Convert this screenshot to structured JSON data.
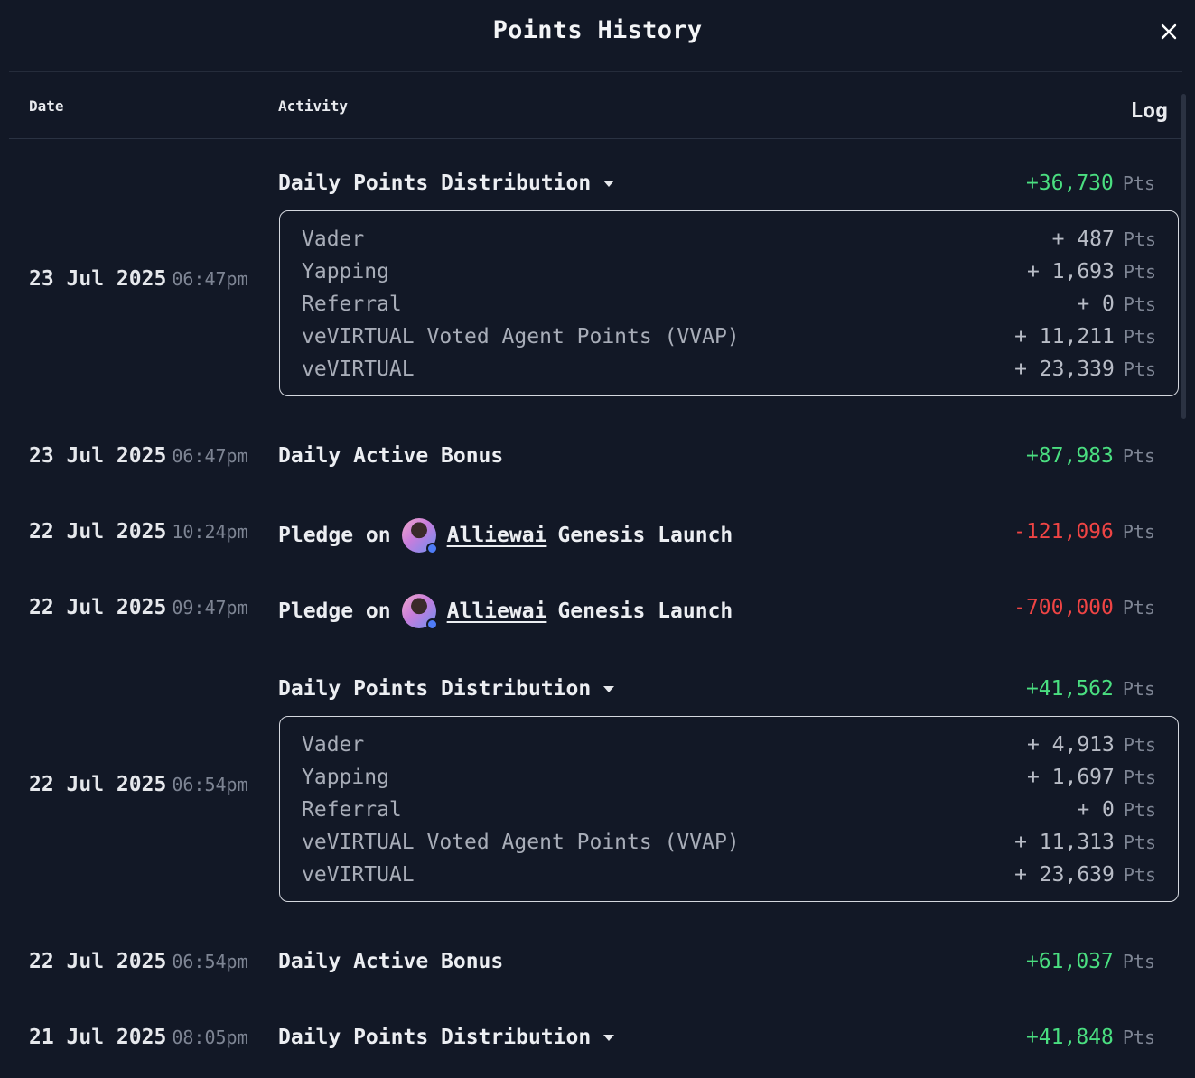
{
  "modal": {
    "title": "Points History",
    "close_label": "×"
  },
  "table": {
    "headers": {
      "date": "Date",
      "activity": "Activity",
      "log": "Log"
    }
  },
  "unit": "Pts",
  "rows": [
    {
      "date": "23 Jul 2025",
      "time": "06:47pm",
      "activity": "Daily Points Distribution",
      "amount": "+36,730",
      "breakdown": [
        {
          "label": "Vader",
          "value": "+ 487"
        },
        {
          "label": "Yapping",
          "value": "+ 1,693"
        },
        {
          "label": "Referral",
          "value": "+ 0"
        },
        {
          "label": "veVIRTUAL Voted Agent Points (VVAP)",
          "value": "+ 11,211"
        },
        {
          "label": "veVIRTUAL",
          "value": "+ 23,339"
        }
      ]
    },
    {
      "date": "23 Jul 2025",
      "time": "06:47pm",
      "activity": "Daily Active Bonus",
      "amount": "+87,983"
    },
    {
      "date": "22 Jul 2025",
      "time": "10:24pm",
      "prefix": "Pledge on",
      "agent": "Alliewai",
      "suffix": "Genesis Launch",
      "amount": "-121,096"
    },
    {
      "date": "22 Jul 2025",
      "time": "09:47pm",
      "prefix": "Pledge on",
      "agent": "Alliewai",
      "suffix": "Genesis Launch",
      "amount": "-700,000"
    },
    {
      "date": "22 Jul 2025",
      "time": "06:54pm",
      "activity": "Daily Points Distribution",
      "amount": "+41,562",
      "breakdown": [
        {
          "label": "Vader",
          "value": "+ 4,913"
        },
        {
          "label": "Yapping",
          "value": "+ 1,697"
        },
        {
          "label": "Referral",
          "value": "+ 0"
        },
        {
          "label": "veVIRTUAL Voted Agent Points (VVAP)",
          "value": "+ 11,313"
        },
        {
          "label": "veVIRTUAL",
          "value": "+ 23,639"
        }
      ]
    },
    {
      "date": "22 Jul 2025",
      "time": "06:54pm",
      "activity": "Daily Active Bonus",
      "amount": "+61,037"
    },
    {
      "date": "21 Jul 2025",
      "time": "08:05pm",
      "activity": "Daily Points Distribution",
      "amount": "+41,848"
    }
  ]
}
